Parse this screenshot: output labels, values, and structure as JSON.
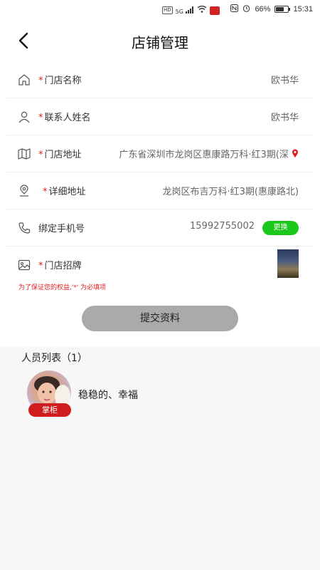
{
  "status_bar": {
    "left_badges": [
      "HD",
      "5G"
    ],
    "battery_percent": "66%",
    "time": "15:31"
  },
  "header": {
    "title": "店铺管理"
  },
  "form": {
    "rows": [
      {
        "icon": "home-icon",
        "required": true,
        "label": "门店名称",
        "value": "欧书华"
      },
      {
        "icon": "person-icon",
        "required": true,
        "label": "联系人姓名",
        "value": "欧书华"
      },
      {
        "icon": "map-icon",
        "required": true,
        "label": "门店地址",
        "value": "广东省深圳市龙岗区惠康路万科·红3期(深"
      },
      {
        "icon": "location-pin-icon",
        "required": true,
        "label": "详细地址",
        "value": "龙岗区布吉万科·红3期(惠康路北)"
      },
      {
        "icon": "phone-icon",
        "required": false,
        "label": "绑定手机号",
        "value": "15992755002",
        "button": "更换"
      },
      {
        "icon": "image-icon",
        "required": true,
        "label": "门店招牌"
      }
    ],
    "required_mark": "*",
    "notice": "为了保证您的权益,'*' 为必填项",
    "submit_label": "提交资料"
  },
  "members": {
    "title": "人员列表（1）",
    "items": [
      {
        "name": "稳稳的、幸福",
        "role": "掌柜"
      }
    ]
  },
  "colors": {
    "required": "#e02020",
    "change_button": "#1bc81b",
    "role_badge": "#d01c1c",
    "submit_button": "#aaaaaa",
    "location_pin": "#e02020"
  }
}
